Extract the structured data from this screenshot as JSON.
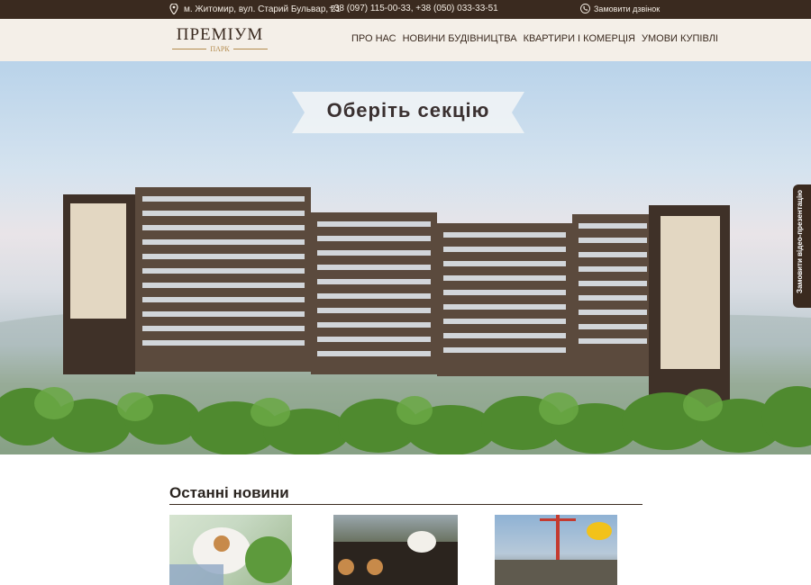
{
  "topbar": {
    "address": "м. Житомир, вул. Старий Бульвар, 21",
    "phones": "+38 (097) 115-00-33, +38 (050) 033-33-51",
    "callback_label": "Замовити дзвінок",
    "icons": [
      "location-pin-icon",
      "phone-icon"
    ]
  },
  "logo": {
    "title": "ПРЕМІУМ",
    "subtitle": "ПАРК"
  },
  "menu": {
    "items": [
      {
        "label": "ПРО НАС"
      },
      {
        "label": "НОВИНИ БУДІВНИЦТВА"
      },
      {
        "label": "КВАРТИРИ І КОМЕРЦІЯ"
      },
      {
        "label": "УМОВИ КУПІВЛІ"
      }
    ]
  },
  "hero": {
    "banner_text": "Оберіть секцію"
  },
  "side_tab": {
    "label": "Замовити відео-презентацію"
  },
  "news": {
    "title": "Останні новини"
  },
  "colors": {
    "brand_dark": "#3a2a1f",
    "nav_bg": "#f4efe8",
    "accent_gold": "#b38a4c"
  }
}
